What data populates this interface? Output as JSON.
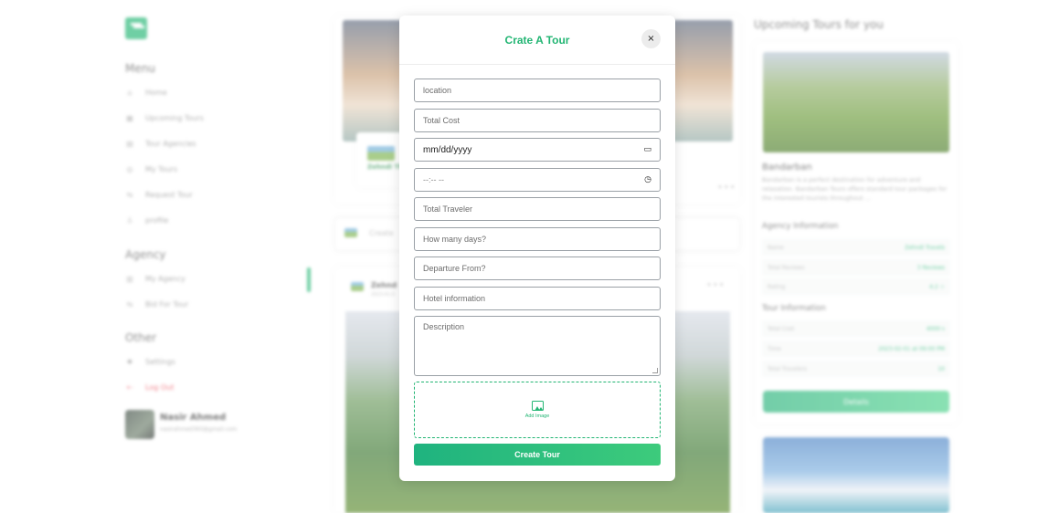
{
  "sidebar": {
    "menu_title": "Menu",
    "menu_items": [
      {
        "label": "Home",
        "icon": "home-icon"
      },
      {
        "label": "Upcoming Tours",
        "icon": "calendar-icon"
      },
      {
        "label": "Tour Agencies",
        "icon": "grid-icon"
      },
      {
        "label": "My Tours",
        "icon": "compass-icon"
      },
      {
        "label": "Request Tour",
        "icon": "route-icon"
      },
      {
        "label": "profile",
        "icon": "user-icon"
      }
    ],
    "agency_title": "Agency",
    "agency_items": [
      {
        "label": "My Agency",
        "icon": "building-icon"
      },
      {
        "label": "Bid For Tour",
        "icon": "route-icon"
      }
    ],
    "other_title": "Other",
    "other_items": [
      {
        "label": "Settings",
        "icon": "gear-icon"
      },
      {
        "label": "Log Out",
        "icon": "logout-icon"
      }
    ],
    "user": {
      "name": "Nasir Ahmed",
      "email": "nasirahmed360@gmail.com"
    }
  },
  "feed": {
    "first_post": {
      "author": "Zehndi",
      "brand": "Zehndi TRAVEL"
    },
    "create_prompt": "Create",
    "second_post": {
      "author": "Zehnd",
      "date": "2023-01-0"
    },
    "more_label": "•••"
  },
  "right_panel": {
    "title": "Upcoming Tours for you",
    "tour": {
      "name": "Bandarban",
      "description": "Bandarban is a perfect destination for adventure and relaxation. Bandarban Tours offers standard tour packages for the interested tourists throughout ...",
      "agency_heading": "Agency Information",
      "agency_rows": [
        {
          "k": "Name",
          "v": "Zehndi Travels"
        },
        {
          "k": "Total Reviews",
          "v": "3 Reviews"
        },
        {
          "k": "Rating",
          "v": "4.2 ☆"
        }
      ],
      "tour_heading": "Tour Information",
      "tour_rows": [
        {
          "k": "Total Cost",
          "v": "4000 ৳"
        },
        {
          "k": "Time",
          "v": "2023-02-01 at 09:00 PM"
        },
        {
          "k": "Total Travelers",
          "v": "10"
        }
      ],
      "details_label": "Details"
    }
  },
  "modal": {
    "title": "Crate A Tour",
    "close_label": "×",
    "fields": {
      "location": {
        "placeholder": "location",
        "value": ""
      },
      "total_cost": {
        "placeholder": "Total Cost",
        "value": ""
      },
      "date": {
        "display": "mm/dd/yyyy",
        "icon": "calendar-icon"
      },
      "time": {
        "display": "--:-- --",
        "icon": "clock-icon"
      },
      "total_traveler": {
        "placeholder": "Total Traveler",
        "value": ""
      },
      "days": {
        "placeholder": "How many days?",
        "value": ""
      },
      "departure": {
        "placeholder": "Departure From?",
        "value": ""
      },
      "hotel": {
        "placeholder": "Hotel information",
        "value": ""
      },
      "description": {
        "placeholder": "Description",
        "value": ""
      }
    },
    "add_image_label": "Add Image",
    "submit_label": "Create Tour",
    "accent_color": "#22b573"
  }
}
